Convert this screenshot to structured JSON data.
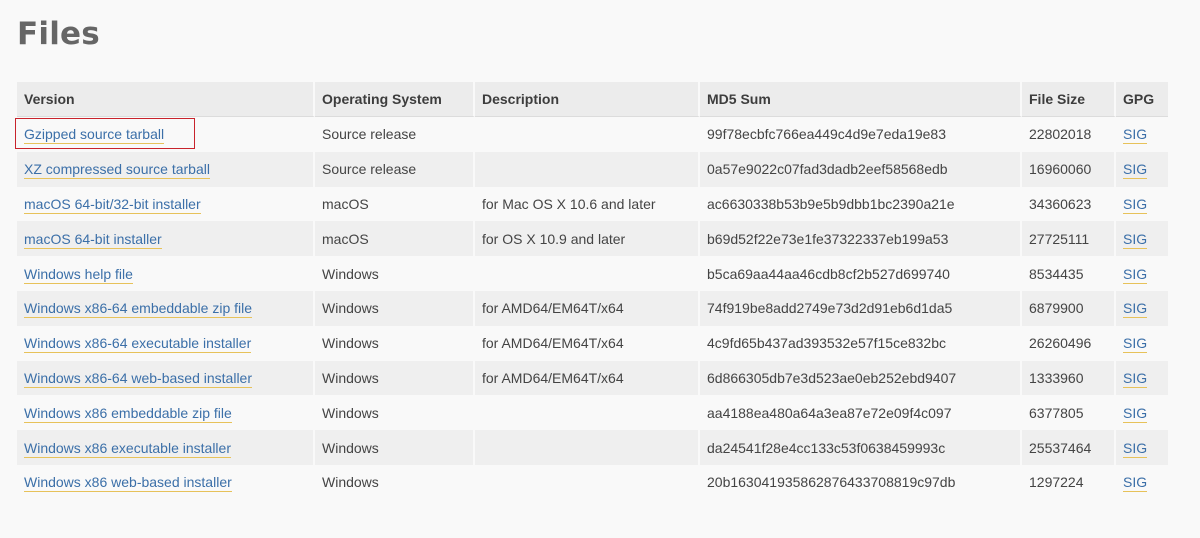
{
  "page": {
    "title": "Files"
  },
  "table": {
    "headers": {
      "version": "Version",
      "os": "Operating System",
      "description": "Description",
      "md5": "MD5 Sum",
      "size": "File Size",
      "gpg": "GPG"
    },
    "rows": [
      {
        "version": "Gzipped source tarball",
        "os": "Source release",
        "description": "",
        "md5": "99f78ecbfc766ea449c4d9e7eda19e83",
        "size": "22802018",
        "gpg": "SIG"
      },
      {
        "version": "XZ compressed source tarball",
        "os": "Source release",
        "description": "",
        "md5": "0a57e9022c07fad3dadb2eef58568edb",
        "size": "16960060",
        "gpg": "SIG"
      },
      {
        "version": "macOS 64-bit/32-bit installer",
        "os": "macOS",
        "description": "for Mac OS X 10.6 and later",
        "md5": "ac6630338b53b9e5b9dbb1bc2390a21e",
        "size": "34360623",
        "gpg": "SIG"
      },
      {
        "version": "macOS 64-bit installer",
        "os": "macOS",
        "description": "for OS X 10.9 and later",
        "md5": "b69d52f22e73e1fe37322337eb199a53",
        "size": "27725111",
        "gpg": "SIG"
      },
      {
        "version": "Windows help file",
        "os": "Windows",
        "description": "",
        "md5": "b5ca69aa44aa46cdb8cf2b527d699740",
        "size": "8534435",
        "gpg": "SIG"
      },
      {
        "version": "Windows x86-64 embeddable zip file",
        "os": "Windows",
        "description": "for AMD64/EM64T/x64",
        "md5": "74f919be8add2749e73d2d91eb6d1da5",
        "size": "6879900",
        "gpg": "SIG"
      },
      {
        "version": "Windows x86-64 executable installer",
        "os": "Windows",
        "description": "for AMD64/EM64T/x64",
        "md5": "4c9fd65b437ad393532e57f15ce832bc",
        "size": "26260496",
        "gpg": "SIG"
      },
      {
        "version": "Windows x86-64 web-based installer",
        "os": "Windows",
        "description": "for AMD64/EM64T/x64",
        "md5": "6d866305db7e3d523ae0eb252ebd9407",
        "size": "1333960",
        "gpg": "SIG"
      },
      {
        "version": "Windows x86 embeddable zip file",
        "os": "Windows",
        "description": "",
        "md5": "aa4188ea480a64a3ea87e72e09f4c097",
        "size": "6377805",
        "gpg": "SIG"
      },
      {
        "version": "Windows x86 executable installer",
        "os": "Windows",
        "description": "",
        "md5": "da24541f28e4cc133c53f0638459993c",
        "size": "25537464",
        "gpg": "SIG"
      },
      {
        "version": "Windows x86 web-based installer",
        "os": "Windows",
        "description": "",
        "md5": "20b163041935862876433708819c97db",
        "size": "1297224",
        "gpg": "SIG"
      }
    ]
  },
  "highlight": {
    "row_index": 0,
    "color": "#c8232c"
  },
  "colors": {
    "link": "#3b6fa8",
    "link_underline": "#e7c25a",
    "header_bg": "#ececec",
    "stripe_bg": "#efefef"
  }
}
